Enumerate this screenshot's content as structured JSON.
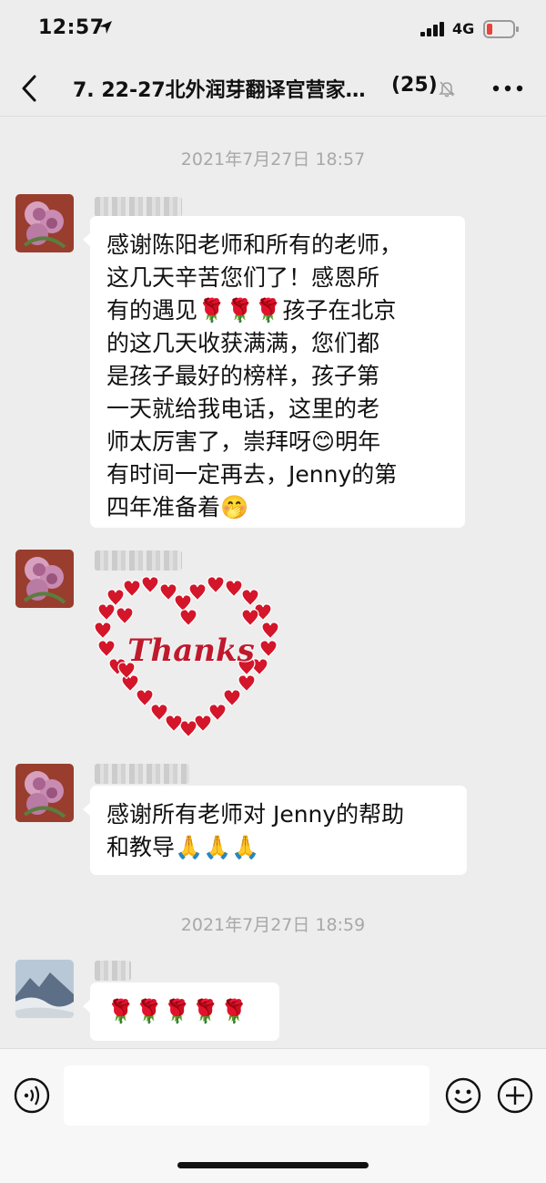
{
  "status_bar": {
    "time": "12:57",
    "network": "4G"
  },
  "header": {
    "back_label": "<",
    "title": "7. 22-27北外润芽翻译官营家…",
    "member_count": "(25)",
    "more_label": "•••"
  },
  "messages": {
    "timestamp_1": "2021年7月27日 18:57",
    "msg1_line1": "感谢陈阳老师和所有的老师，",
    "msg1_line2": "这几天辛苦您们了！感恩所",
    "msg1_line3": "有的遇见🌹🌹🌹孩子在北京",
    "msg1_line4": "的这几天收获满满，您们都",
    "msg1_line5": "是孩子最好的榜样，孩子第",
    "msg1_line6": "一天就给我电话，这里的老",
    "msg1_line7": "师太厉害了，崇拜呀😊明年",
    "msg1_line8": "有时间一定再去，Jenny的第",
    "msg1_line9": "四年准备着🤭",
    "sticker_text": "Thanks",
    "msg3_line1": "感谢所有老师对 Jenny的帮助",
    "msg3_line2": "和教导🙏🙏🙏",
    "timestamp_2": "2021年7月27日 18:59",
    "msg4": "🌹🌹🌹🌹🌹"
  },
  "colors": {
    "background": "#ededed",
    "bubble": "#ffffff",
    "timestamp": "#a8a8a8",
    "heart": "#d3162a"
  }
}
